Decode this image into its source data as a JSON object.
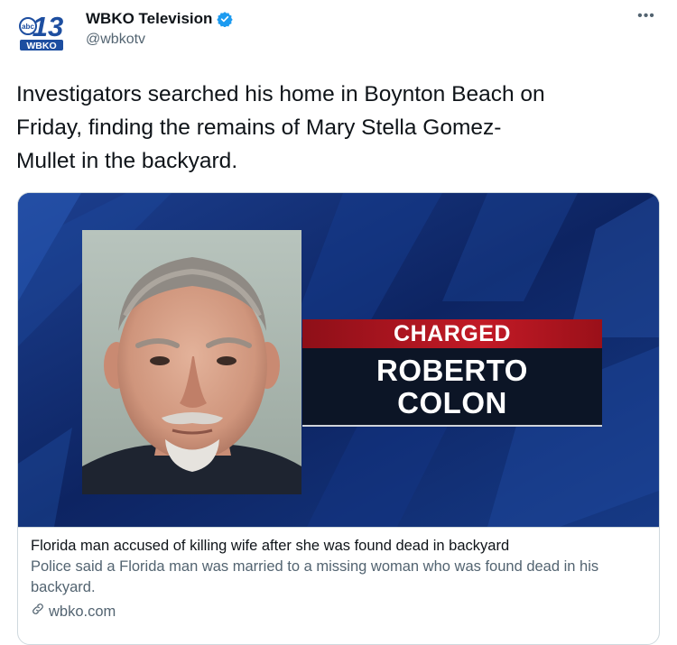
{
  "account": {
    "display_name": "WBKO Television",
    "handle": "@wbkotv",
    "logo_number": "13",
    "logo_network": "abc",
    "logo_callsign": "WBKO",
    "verified": true
  },
  "menu": {
    "more_label": "•••"
  },
  "tweet": {
    "text_lines": [
      "Investigators searched his home in Boynton Beach on",
      "Friday, finding the remains of Mary Stella Gomez-",
      "Mullet in the backyard."
    ]
  },
  "card": {
    "graphic": {
      "banner_label": "CHARGED",
      "name_line_1": "ROBERTO",
      "name_line_2": "COLON"
    },
    "title": "Florida man accused of killing wife after she was found dead in backyard",
    "description": "Police said a Florida man was married to a missing woman who was found dead in his backyard.",
    "domain": "wbko.com"
  },
  "colors": {
    "brand_blue": "#1d4ea0",
    "verified_blue": "#1d9bf0",
    "graphic_navy": "#0f2a6c",
    "banner_red": "#c21a26",
    "text_primary": "#0f1419",
    "text_secondary": "#536471"
  }
}
